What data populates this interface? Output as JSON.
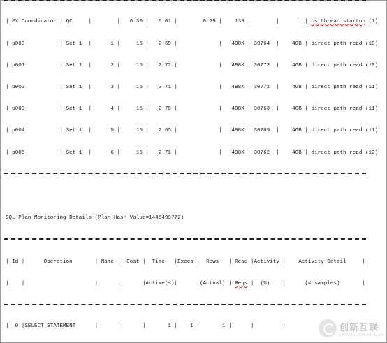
{
  "px_rows": [
    {
      "text": "| PX Coordinator | QC     |        |   0.30 |   0.01 |        0.29 |    139 |        |      . | ",
      "tail": "os thread startup",
      "suffix": " (1)"
    },
    {
      "text": "| p000           | Set 1  |      1 |     15 |   2.69 |             |   498K | 30764  |    4GB | direct path read (10)"
    },
    {
      "text": "| p001           | Set 1  |      2 |     15 |   2.72 |             |   498K | 30772  |    4GB | direct path read (10)"
    },
    {
      "text": "| p002           | Set 1  |      3 |     15 |   2.71 |             |   498K | 30771  |    4GB | direct path read (11)"
    },
    {
      "text": "| p003           | Set 1  |      4 |     15 |   2.78 |             |   498K | 30763  |    4GB | direct path read (11)"
    },
    {
      "text": "| p004           | Set 1  |      5 |     15 |   2.65 |             |   498K | 30769  |    4GB | direct path read (11)"
    },
    {
      "text": "| p005           | Set 1  |      6 |     15 |   2.71 |             |   498K | 30762  |    4GB | direct path read (12)"
    }
  ],
  "plan_title": "SQL Plan Monitoring Details (Plan Hash Value=1446499772)",
  "plan_header_1": "| Id |      Operation       | Name  | Cost |  Time   |Execs |  Rows   | Read |Activity |    Activity Detail     |",
  "plan_header_2_pre": "|    |                      |       |      |Active(s)|      |(Actual) | ",
  "plan_header_2_wavy": "Reqs",
  "plan_header_2_post": " |  (%)    |      (# samples)       |",
  "plan_row_0": "|  0 |SELECT STATEMENT      |       |      |       1 |    1 |       1 |      |         |",
  "watermark": {
    "cn": "创新互联",
    "en": "CHUANG XIN HU LIAN"
  }
}
